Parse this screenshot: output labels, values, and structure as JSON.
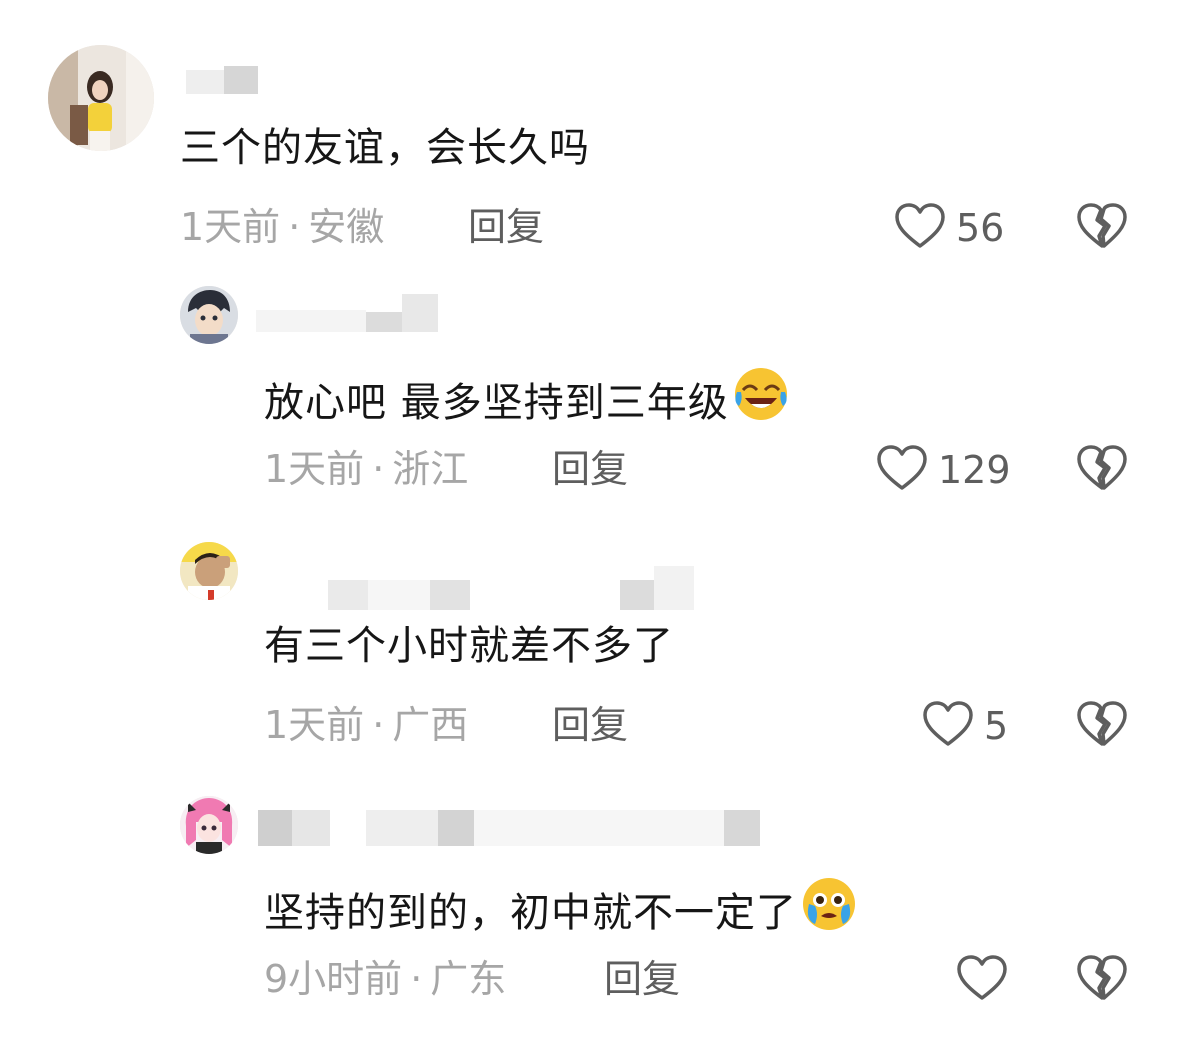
{
  "comments": [
    {
      "text": "三个的友谊，会长久吗",
      "time": "1天前",
      "location": "安徽",
      "reply_label": "回复",
      "likes": "56"
    },
    {
      "text": "放心吧 最多坚持到三年级",
      "time": "1天前",
      "location": "浙江",
      "reply_label": "回复",
      "likes": "129",
      "emoji": "crying-laughing-emoji"
    },
    {
      "text": "有三个小时就差不多了",
      "time": "1天前",
      "location": "广西",
      "reply_label": "回复",
      "likes": "5"
    },
    {
      "text": "坚持的到的，初中就不一定了",
      "time": "9小时前",
      "location": "广东",
      "reply_label": "回复",
      "likes": "",
      "emoji": "teary-emoji"
    }
  ],
  "separator": "·",
  "icons": {
    "like": "heart-outline-icon",
    "dislike": "broken-heart-icon"
  },
  "colors": {
    "text": "#161616",
    "meta": "#a6a6a6",
    "action": "#5e5e5e",
    "emoji": "#f7c432"
  }
}
